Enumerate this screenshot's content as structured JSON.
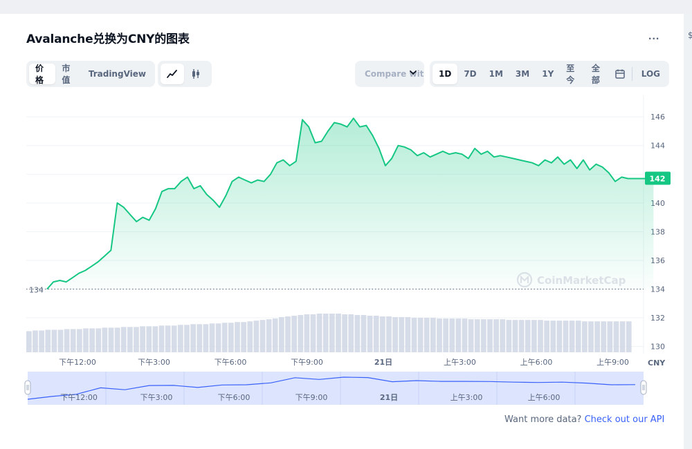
{
  "title": "Avalanche兑换为CNY的图表",
  "more_label": "...",
  "edge_mark": "$",
  "chart_types": [
    {
      "label": "价格",
      "active": true
    },
    {
      "label": "市值",
      "active": false
    },
    {
      "label": "TradingView",
      "active": false
    }
  ],
  "style_icons": [
    "line-chart-icon",
    "candlestick-icon"
  ],
  "compare": {
    "label": "Compare with"
  },
  "ranges": [
    {
      "label": "1D",
      "active": true
    },
    {
      "label": "7D",
      "active": false
    },
    {
      "label": "1M",
      "active": false
    },
    {
      "label": "3M",
      "active": false
    },
    {
      "label": "1Y",
      "active": false
    },
    {
      "label": "至今",
      "active": false
    },
    {
      "label": "全部",
      "active": false
    }
  ],
  "log_label": "LOG",
  "footer": {
    "text": "Want more data? ",
    "link": "Check out our API"
  },
  "colors": {
    "line": "#16c784",
    "accent": "#3861fb",
    "volume": "#cfd6e4",
    "nav_fill": "#dde4fd"
  },
  "watermark": "CoinMarketCap",
  "chart_data": {
    "type": "area",
    "currency": "CNY",
    "yticks": [
      130,
      132,
      134,
      136,
      138,
      140,
      142,
      144,
      146
    ],
    "ylim": [
      129.5,
      147.5
    ],
    "xticks": [
      "下午12:00",
      "下午3:00",
      "下午6:00",
      "下午9:00",
      "21日",
      "上午3:00",
      "上午6:00",
      "上午9:00"
    ],
    "nav_xticks": [
      "下午12:00",
      "下午3:00",
      "下午6:00",
      "下午9:00",
      "21日",
      "上午3:00",
      "上午6:00"
    ],
    "open_price": 134,
    "open_label": "134",
    "last_price": 141.7,
    "last_label": "142",
    "price_hours": [
      0,
      0.25,
      0.5,
      0.75,
      1,
      1.25,
      1.5,
      1.75,
      2,
      2.25,
      2.5,
      2.75,
      3,
      3.25,
      3.5,
      3.75,
      4,
      4.25,
      4.5,
      4.75,
      5,
      5.25,
      5.5,
      5.75,
      6,
      6.25,
      6.5,
      6.75,
      7,
      7.25,
      7.5,
      7.75,
      8,
      8.25,
      8.5,
      8.75,
      9,
      9.25,
      9.5,
      9.75,
      10,
      10.25,
      10.5,
      10.75,
      11,
      11.25,
      11.5,
      11.75,
      12,
      12.25,
      12.5,
      12.75,
      13,
      13.25,
      13.5,
      13.75,
      14,
      14.25,
      14.5,
      14.75,
      15,
      15.25,
      15.5,
      15.75,
      16,
      16.25,
      16.5,
      16.75,
      17,
      17.25,
      17.5,
      17.75,
      18,
      18.25,
      18.5,
      18.75,
      19,
      19.25,
      19.5,
      19.75,
      20,
      20.25,
      20.5,
      20.75,
      21,
      21.25,
      21.5,
      21.75,
      22,
      22.25,
      22.5,
      22.75,
      23,
      23.25,
      23.5,
      23.75
    ],
    "price_values": [
      134.0,
      134.5,
      134.6,
      134.5,
      134.8,
      135.1,
      135.3,
      135.6,
      135.9,
      136.3,
      136.7,
      140.0,
      139.7,
      139.2,
      138.7,
      139.0,
      138.8,
      139.6,
      140.8,
      141.0,
      141.0,
      141.5,
      141.8,
      141.0,
      141.2,
      140.6,
      140.2,
      139.7,
      140.5,
      141.5,
      141.8,
      141.6,
      141.4,
      141.6,
      141.5,
      142.0,
      142.8,
      143.0,
      142.6,
      142.9,
      145.8,
      145.3,
      144.2,
      144.3,
      145.0,
      145.6,
      145.5,
      145.3,
      145.9,
      145.3,
      145.4,
      144.7,
      143.8,
      142.6,
      143.1,
      144.0,
      143.9,
      143.7,
      143.3,
      143.5,
      143.2,
      143.4,
      143.6,
      143.4,
      143.5,
      143.4,
      143.1,
      143.8,
      143.4,
      143.6,
      143.2,
      143.3,
      143.2,
      143.1,
      143.0,
      142.9,
      142.8,
      142.6,
      143.0,
      142.8,
      143.2,
      142.7,
      143.0,
      142.4,
      143.0,
      142.3,
      142.7,
      142.5,
      142.1,
      141.5,
      141.8,
      141.7,
      141.7,
      141.7,
      141.7,
      141.7
    ],
    "volume_values": [
      30,
      31,
      31,
      32,
      32,
      32,
      33,
      33,
      33,
      34,
      34,
      34,
      35,
      35,
      35,
      36,
      36,
      36,
      37,
      37,
      37,
      38,
      38,
      38,
      39,
      39,
      40,
      40,
      40,
      41,
      41,
      42,
      42,
      43,
      43,
      44,
      45,
      46,
      47,
      48,
      50,
      51,
      52,
      53,
      54,
      54,
      55,
      55,
      55,
      55,
      54,
      54,
      53,
      53,
      52,
      52,
      51,
      51,
      50,
      50,
      50,
      49,
      49,
      49,
      49,
      48,
      48,
      48,
      48,
      48,
      47,
      47,
      47,
      47,
      47,
      47,
      46,
      46,
      46,
      46,
      46,
      46,
      45,
      45,
      45,
      45,
      45,
      45,
      44,
      44,
      44,
      44,
      44,
      44,
      44,
      44
    ],
    "nav_values": [
      134.0,
      135.5,
      136.6,
      140.0,
      139.0,
      141.2,
      141.3,
      140.2,
      141.5,
      141.6,
      142.6,
      145.3,
      144.4,
      145.6,
      145.4,
      143.2,
      143.8,
      143.4,
      143.4,
      143.3,
      143.0,
      142.8,
      143.0,
      142.5,
      141.6,
      141.7
    ]
  }
}
